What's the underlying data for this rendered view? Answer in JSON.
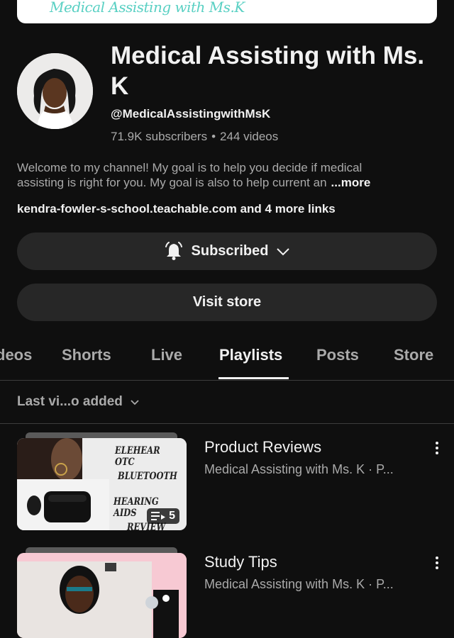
{
  "banner": {
    "logo_text": "Medical Assisting with Ms.K"
  },
  "channel": {
    "title": "Medical Assisting with Ms. K",
    "handle": "@MedicalAssistingwithMsK",
    "subscribers": "71.9K subscribers",
    "separator": "•",
    "videos": "244 videos",
    "description_line1": "Welcome to my channel! My goal is to help you decide if medical",
    "description_line2": "assisting is right for you. My goal is also to help current an",
    "more_label": "...more",
    "links_text": "kendra-fowler-s-school.teachable.com and 4 more links"
  },
  "actions": {
    "subscribed_label": "Subscribed",
    "visit_store_label": "Visit store"
  },
  "tabs": [
    {
      "label": "deos"
    },
    {
      "label": "Shorts"
    },
    {
      "label": "Live"
    },
    {
      "label": "Playlists"
    },
    {
      "label": "Posts"
    },
    {
      "label": "Store"
    }
  ],
  "sort": {
    "label": "Last vi...o added"
  },
  "playlists": [
    {
      "title": "Product Reviews",
      "subtitle": "Medical Assisting with Ms. K · P...",
      "count": "5",
      "thumb_lines": [
        "ELEHEAR OTC",
        "BLUETOOTH",
        "HEARING AIDS",
        "REVIEW"
      ]
    },
    {
      "title": "Study Tips",
      "subtitle": "Medical Assisting with Ms. K · P..."
    }
  ],
  "colors": {
    "background": "#0f0f0f",
    "button": "#272727",
    "text_primary": "#f1f1f1",
    "text_secondary": "#aaaaaa"
  }
}
